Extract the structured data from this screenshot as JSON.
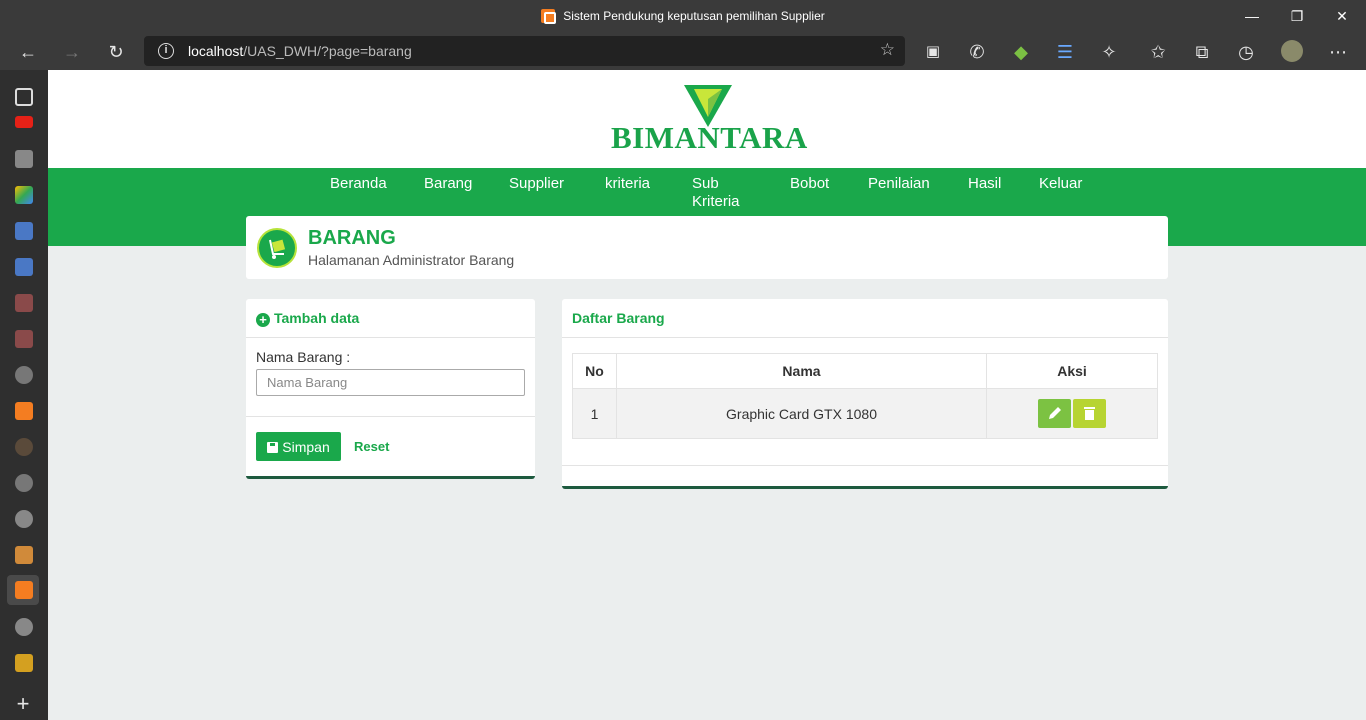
{
  "browser": {
    "window_title": "Sistem Pendukung keputusan pemilihan Supplier",
    "url_host": "localhost",
    "url_path": "/UAS_DWH/?page=barang"
  },
  "brand": {
    "name": "BIMANTARA"
  },
  "nav": [
    {
      "label": "Beranda"
    },
    {
      "label": "Barang"
    },
    {
      "label": "Supplier"
    },
    {
      "label": "kriteria"
    },
    {
      "label": "Sub Kriteria"
    },
    {
      "label": "Bobot"
    },
    {
      "label": "Penilaian"
    },
    {
      "label": "Hasil"
    },
    {
      "label": "Keluar"
    }
  ],
  "page": {
    "title": "BARANG",
    "subtitle": "Halamanan Administrator Barang"
  },
  "form": {
    "heading": "Tambah data",
    "field_label": "Nama Barang :",
    "field_placeholder": "Nama Barang",
    "save_label": "Simpan",
    "reset_label": "Reset"
  },
  "list": {
    "heading": "Daftar Barang",
    "columns": [
      "No",
      "Nama",
      "Aksi"
    ],
    "rows": [
      {
        "no": "1",
        "nama": "Graphic Card GTX 1080"
      }
    ]
  },
  "colors": {
    "accent": "#1aa84b",
    "edit": "#7cc242",
    "delete": "#b7d432"
  }
}
